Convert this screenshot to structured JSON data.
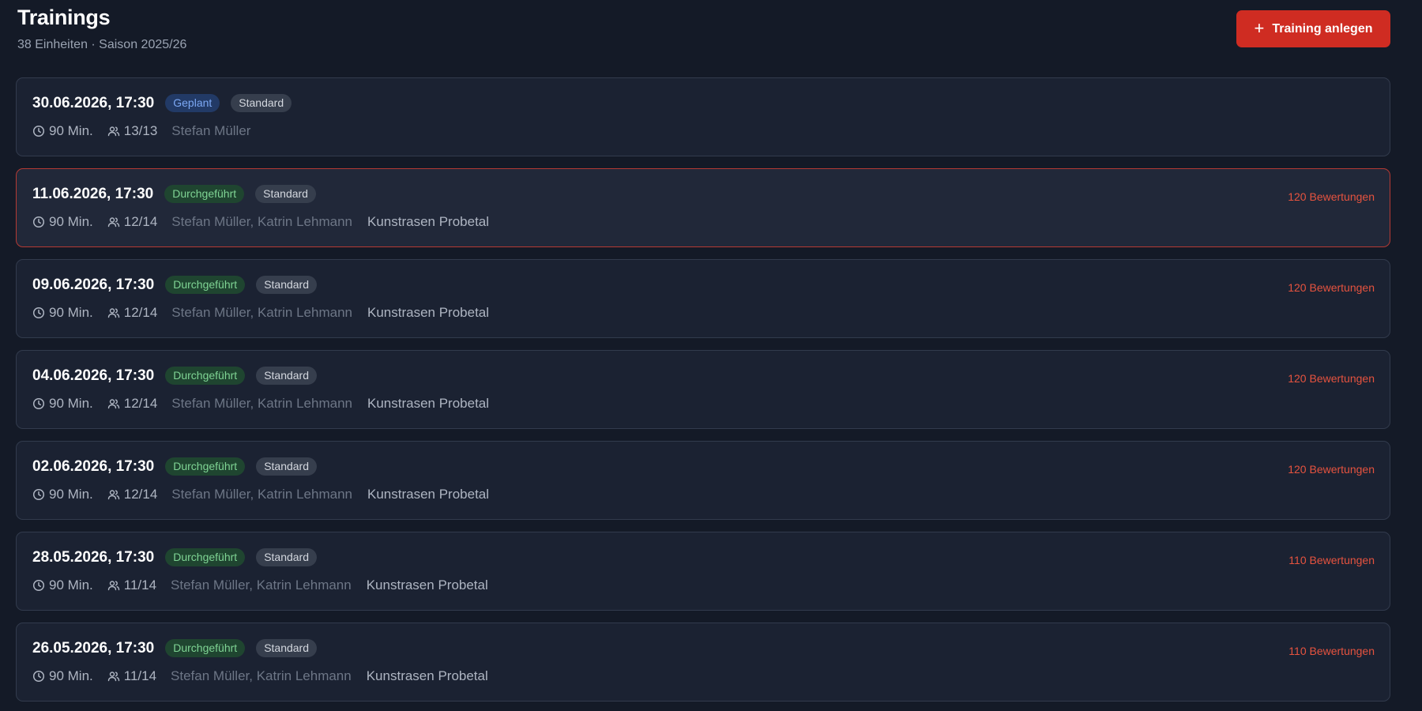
{
  "header": {
    "title": "Trainings",
    "subtitle": "38 Einheiten · Saison 2025/26",
    "add_button_label": "Training anlegen"
  },
  "colors": {
    "background": "#141a27",
    "card": "#1b2232",
    "accent_red": "#cf2c22",
    "ratings_text": "#e6533f",
    "badge_done": "#7fd494",
    "badge_planned": "#7ca8f4"
  },
  "icons": {
    "add": "plus-icon",
    "duration": "clock-icon",
    "attendance": "users-icon"
  },
  "trainings": [
    {
      "date": "30.06.2026, 17:30",
      "status": "Geplant",
      "status_kind": "planned",
      "type": "Standard",
      "duration": "90 Min.",
      "attendance": "13/13",
      "trainers": "Stefan Müller",
      "location": "",
      "ratings": "",
      "highlighted": false
    },
    {
      "date": "11.06.2026, 17:30",
      "status": "Durchgeführt",
      "status_kind": "done",
      "type": "Standard",
      "duration": "90 Min.",
      "attendance": "12/14",
      "trainers": "Stefan Müller, Katrin Lehmann",
      "location": "Kunstrasen Probetal",
      "ratings": "120 Bewertungen",
      "highlighted": true
    },
    {
      "date": "09.06.2026, 17:30",
      "status": "Durchgeführt",
      "status_kind": "done",
      "type": "Standard",
      "duration": "90 Min.",
      "attendance": "12/14",
      "trainers": "Stefan Müller, Katrin Lehmann",
      "location": "Kunstrasen Probetal",
      "ratings": "120 Bewertungen",
      "highlighted": false
    },
    {
      "date": "04.06.2026, 17:30",
      "status": "Durchgeführt",
      "status_kind": "done",
      "type": "Standard",
      "duration": "90 Min.",
      "attendance": "12/14",
      "trainers": "Stefan Müller, Katrin Lehmann",
      "location": "Kunstrasen Probetal",
      "ratings": "120 Bewertungen",
      "highlighted": false
    },
    {
      "date": "02.06.2026, 17:30",
      "status": "Durchgeführt",
      "status_kind": "done",
      "type": "Standard",
      "duration": "90 Min.",
      "attendance": "12/14",
      "trainers": "Stefan Müller, Katrin Lehmann",
      "location": "Kunstrasen Probetal",
      "ratings": "120 Bewertungen",
      "highlighted": false
    },
    {
      "date": "28.05.2026, 17:30",
      "status": "Durchgeführt",
      "status_kind": "done",
      "type": "Standard",
      "duration": "90 Min.",
      "attendance": "11/14",
      "trainers": "Stefan Müller, Katrin Lehmann",
      "location": "Kunstrasen Probetal",
      "ratings": "110 Bewertungen",
      "highlighted": false
    },
    {
      "date": "26.05.2026, 17:30",
      "status": "Durchgeführt",
      "status_kind": "done",
      "type": "Standard",
      "duration": "90 Min.",
      "attendance": "11/14",
      "trainers": "Stefan Müller, Katrin Lehmann",
      "location": "Kunstrasen Probetal",
      "ratings": "110 Bewertungen",
      "highlighted": false
    }
  ]
}
